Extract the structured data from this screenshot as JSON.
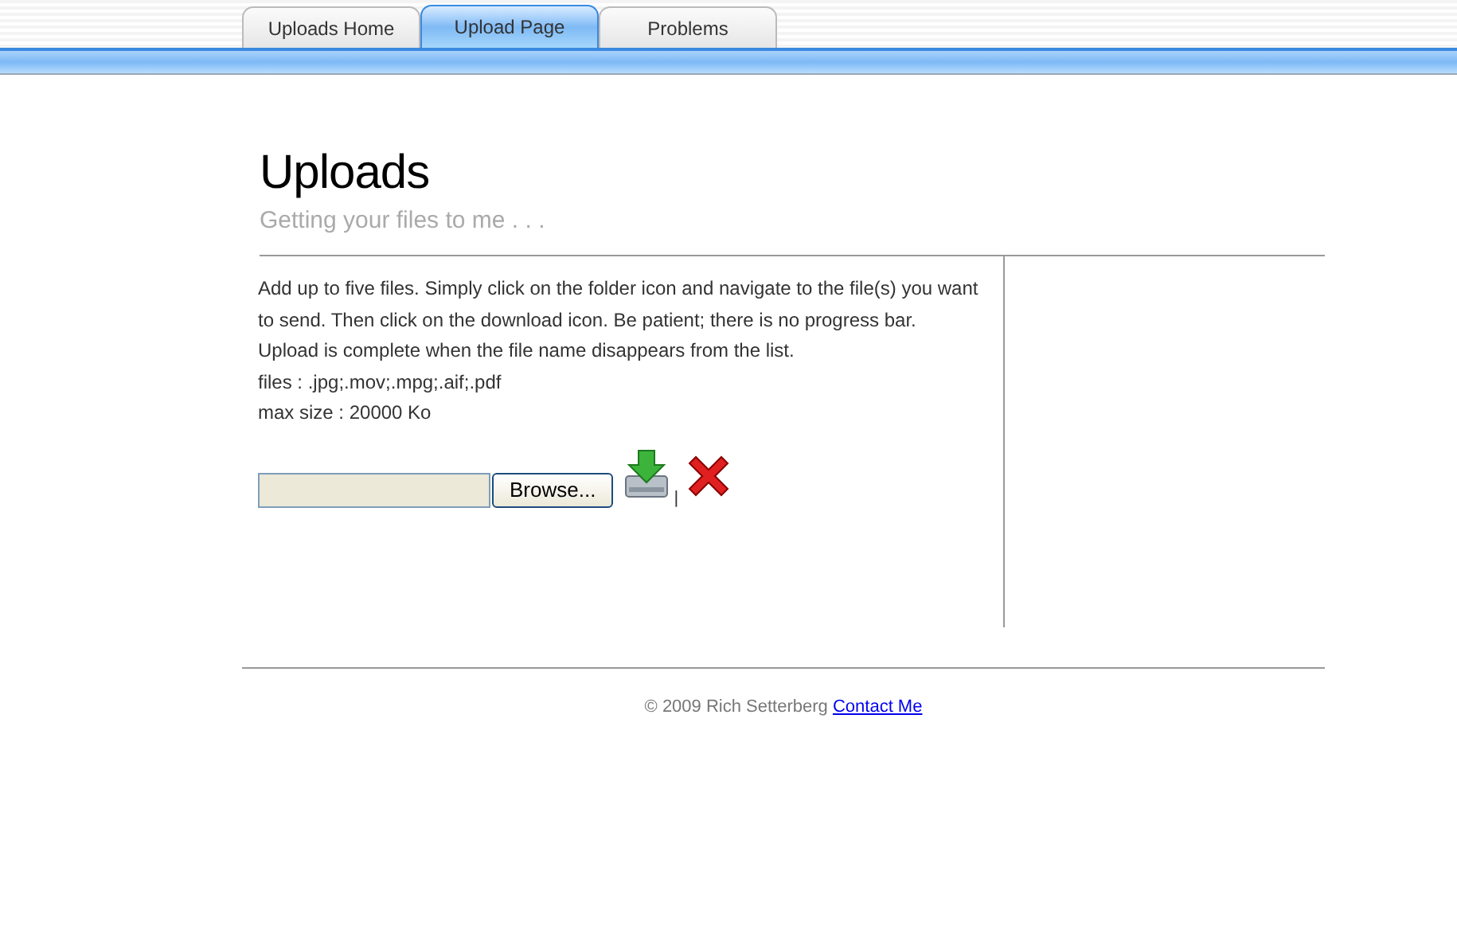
{
  "tabs": [
    {
      "label": "Uploads Home",
      "selected": false
    },
    {
      "label": "Upload Page",
      "selected": true
    },
    {
      "label": "Problems",
      "selected": false
    }
  ],
  "header": {
    "title": "Uploads",
    "subtitle": "Getting your files to me . . ."
  },
  "content": {
    "paragraphs": [
      "Add up to five files. Simply click on the folder icon and navigate to the file(s) you want to send. Then click on the download icon. Be patient; there is no progress bar. Upload is complete when the file name disappears from the list.",
      "files : .jpg;.mov;.mpg;.aif;.pdf",
      "max size : 20000 Ko"
    ],
    "upload": {
      "browse_button": "Browse...",
      "separator": "|"
    }
  },
  "footer": {
    "copyright": "© 2009 Rich Setterberg",
    "link": "Contact Me"
  }
}
